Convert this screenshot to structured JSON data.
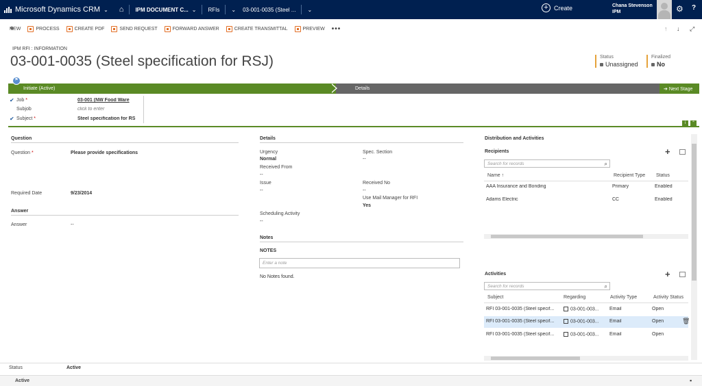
{
  "nav": {
    "app_title": "Microsoft Dynamics CRM",
    "area": "IPM DOCUMENT C...",
    "entity": "RFIs",
    "record": "03-001-0035 (Steel ...",
    "create_label": "Create",
    "user_name": "Chana Stevenson",
    "user_org": "IPM"
  },
  "commands": {
    "new": "NEW",
    "process": "PROCESS",
    "create_pdf": "CREATE PDF",
    "send_request": "SEND REQUEST",
    "forward_answer": "FORWARD ANSWER",
    "create_transmittal": "CREATE TRANSMITTAL",
    "preview": "PREVIEW",
    "more": "•••"
  },
  "header": {
    "entity_form": "IPM RFI : INFORMATION",
    "title": "03-001-0035 (Steel specification for RSJ)",
    "status_label": "Status",
    "status_value": "Unassigned",
    "finalized_label": "Finalized",
    "finalized_value": "No"
  },
  "process": {
    "active_stage": "Initiate (Active)",
    "next_stage_name": "Details",
    "next_stage_button": "Next Stage",
    "fields": [
      {
        "label": "Job",
        "value": "03-001 (NW Food Ware",
        "required": true
      },
      {
        "label": "Subjob",
        "value": "click to enter"
      },
      {
        "label": "Subject",
        "value": "Steel specification for RS",
        "required": true
      }
    ]
  },
  "question": {
    "section": "Question",
    "question_label": "Question",
    "question_value": "Please provide specifications",
    "required_date_label": "Required Date",
    "required_date_value": "9/23/2014"
  },
  "answer": {
    "section": "Answer",
    "answer_label": "Answer",
    "answer_value": "--"
  },
  "details": {
    "section": "Details",
    "urgency_label": "Urgency",
    "urgency_value": "Normal",
    "spec_label": "Spec. Section",
    "spec_value": "--",
    "received_from_label": "Received From",
    "received_from_value": "--",
    "issue_label": "Issue",
    "issue_value": "--",
    "received_no_label": "Received No",
    "received_no_value": "--",
    "mail_label": "Use Mail Manager for RFI",
    "mail_value": "Yes",
    "sched_label": "Scheduling Activity",
    "sched_value": "--"
  },
  "notes": {
    "section": "Notes",
    "tab": "NOTES",
    "placeholder": "Enter a note",
    "empty": "No Notes found."
  },
  "distribution": {
    "section": "Distribution and Activities",
    "recipients_title": "Recipients",
    "search_placeholder": "Search for records",
    "columns": [
      "Name ↑",
      "Recipient Type",
      "Status"
    ],
    "rows": [
      [
        "AAA Insurance and Bonding",
        "Primary",
        "Enabled"
      ],
      [
        "Adams Electric",
        "CC",
        "Enabled"
      ]
    ]
  },
  "activities": {
    "title": "Activities",
    "search_placeholder": "Search for records",
    "columns": [
      "Subject",
      "Regarding",
      "Activity Type",
      "Activity Status"
    ],
    "rows": [
      [
        "RFI 03-001-0035 (Steel specif...",
        "03-001-003...",
        "Email",
        "Open"
      ],
      [
        "RFI 03-001-0035 (Steel specif...",
        "03-001-003...",
        "Email",
        "Open"
      ],
      [
        "RFI 03-001-0035 (Steel specif...",
        "03-001-003...",
        "Email",
        "Open"
      ]
    ]
  },
  "footer": {
    "status_label": "Status",
    "status_value": "Active",
    "bar_status": "Active"
  }
}
